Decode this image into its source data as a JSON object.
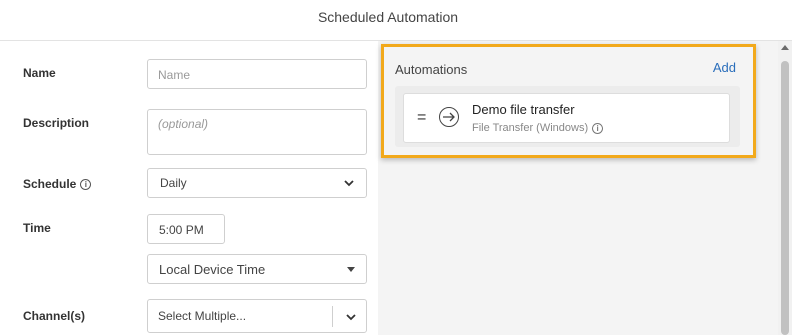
{
  "header": {
    "title": "Scheduled Automation"
  },
  "form": {
    "name_label": "Name",
    "name_placeholder": "Name",
    "description_label": "Description",
    "description_placeholder": "(optional)",
    "schedule_label": "Schedule",
    "schedule_value": "Daily",
    "time_label": "Time",
    "time_value": "5:00 PM",
    "timezone_value": "Local Device Time",
    "channels_label": "Channel(s)",
    "channels_placeholder": "Select Multiple..."
  },
  "automations": {
    "title": "Automations",
    "add_label": "Add",
    "items": [
      {
        "title": "Demo file transfer",
        "subtitle": "File Transfer (Windows)"
      }
    ]
  },
  "colors": {
    "highlight": "#f2a91b",
    "link": "#2a6ebb"
  },
  "icons": [
    "info-icon",
    "chevron-down-icon",
    "caret-down-icon",
    "drag-handle-icon",
    "arrow-right-icon"
  ]
}
